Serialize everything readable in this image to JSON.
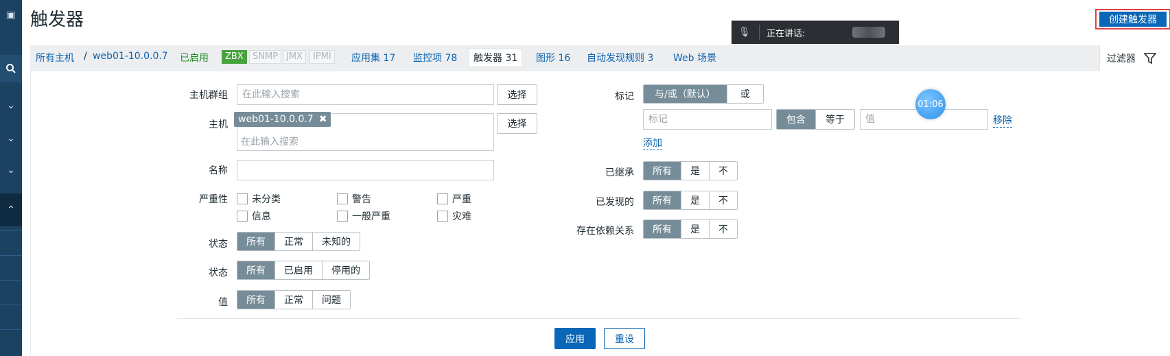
{
  "page": {
    "title": "触发器"
  },
  "header": {
    "create_button": "创建触发器"
  },
  "speaking_overlay": {
    "text": "正在讲话:"
  },
  "breadcrumbs": {
    "all_hosts": "所有主机",
    "separator": "/",
    "host": "web01-10.0.0.7",
    "status": "已启用"
  },
  "availability": {
    "zbx": "ZBX",
    "snmp": "SNMP",
    "jmx": "JMX",
    "ipmi": "IPMI"
  },
  "tabs": [
    {
      "label": "应用集 17"
    },
    {
      "label": "监控项 78"
    },
    {
      "label": "触发器 31"
    },
    {
      "label": "图形 16"
    },
    {
      "label": "自动发现规则 3"
    },
    {
      "label": "Web 场景"
    }
  ],
  "filter_tab": {
    "label": "过滤器"
  },
  "filter": {
    "host_group": {
      "label": "主机群组",
      "placeholder": "在此输入搜索",
      "select": "选择"
    },
    "host": {
      "label": "主机",
      "chip": "web01-10.0.0.7",
      "placeholder": "在此输入搜索",
      "select": "选择"
    },
    "name": {
      "label": "名称",
      "value": ""
    },
    "severity": {
      "label": "严重性",
      "options": [
        "未分类",
        "警告",
        "严重",
        "信息",
        "一般严重",
        "灾难"
      ]
    },
    "state": {
      "label": "状态",
      "options": [
        "所有",
        "正常",
        "未知的"
      ],
      "selected": "所有"
    },
    "status": {
      "label": "状态",
      "options": [
        "所有",
        "已启用",
        "停用的"
      ],
      "selected": "所有"
    },
    "value": {
      "label": "值",
      "options": [
        "所有",
        "正常",
        "问题"
      ],
      "selected": "所有"
    },
    "tags": {
      "label": "标记",
      "operator_options": [
        "与/或（默认）",
        "或"
      ],
      "tag_placeholder": "标记",
      "match_options": [
        "包含",
        "等于"
      ],
      "value_placeholder": "值",
      "remove": "移除",
      "add": "添加"
    },
    "inherited": {
      "label": "已继承",
      "options": [
        "所有",
        "是",
        "不"
      ]
    },
    "discovered": {
      "label": "已发现的",
      "options": [
        "所有",
        "是",
        "不"
      ]
    },
    "dependencies": {
      "label": "存在依赖关系",
      "options": [
        "所有",
        "是",
        "不"
      ]
    },
    "apply": "应用",
    "reset": "重设"
  },
  "timer": {
    "text": "01:06"
  },
  "colors": {
    "primary": "#0a66b7",
    "segment_active": "#768d99",
    "enabled": "#1f8d22",
    "nav": "#1c4262"
  }
}
